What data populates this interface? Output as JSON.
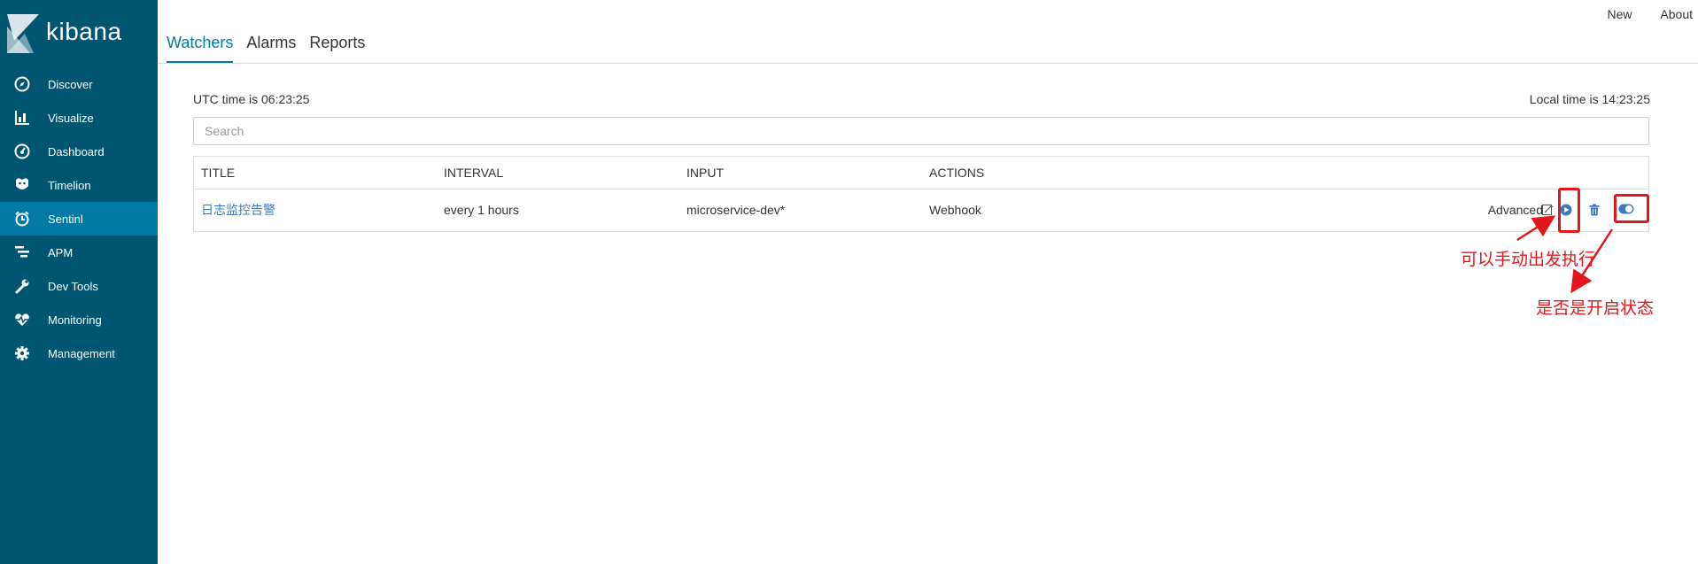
{
  "app": {
    "logo_text": "kibana"
  },
  "sidebar": {
    "items": [
      {
        "label": "Discover",
        "icon": "compass-icon"
      },
      {
        "label": "Visualize",
        "icon": "bar-chart-icon"
      },
      {
        "label": "Dashboard",
        "icon": "dashboard-icon"
      },
      {
        "label": "Timelion",
        "icon": "timelion-icon"
      },
      {
        "label": "Sentinl",
        "icon": "alarm-clock-icon",
        "active": true
      },
      {
        "label": "APM",
        "icon": "apm-icon"
      },
      {
        "label": "Dev Tools",
        "icon": "wrench-icon"
      },
      {
        "label": "Monitoring",
        "icon": "heartbeat-icon"
      },
      {
        "label": "Management",
        "icon": "gear-icon"
      }
    ]
  },
  "top_links": {
    "new": "New",
    "about": "About"
  },
  "tabs": [
    {
      "label": "Watchers",
      "active": true
    },
    {
      "label": "Alarms"
    },
    {
      "label": "Reports"
    }
  ],
  "time": {
    "utc": "UTC time is 06:23:25",
    "local": "Local time is 14:23:25"
  },
  "search": {
    "placeholder": "Search",
    "value": ""
  },
  "table": {
    "headers": [
      "TITLE",
      "INTERVAL",
      "INPUT",
      "ACTIONS"
    ],
    "rows": [
      {
        "title": "日志监控告警",
        "interval": "every 1 hours",
        "input": "microservice-dev*",
        "actions": "Webhook",
        "advanced_label": "Advanced"
      }
    ]
  },
  "annotations": {
    "execute_note": "可以手动出发执行",
    "enabled_note": "是否是开启状态"
  },
  "colors": {
    "sidebar": "#005571",
    "active": "#0079a5",
    "annotation": "#e3161b",
    "link": "#3a7bbf"
  }
}
